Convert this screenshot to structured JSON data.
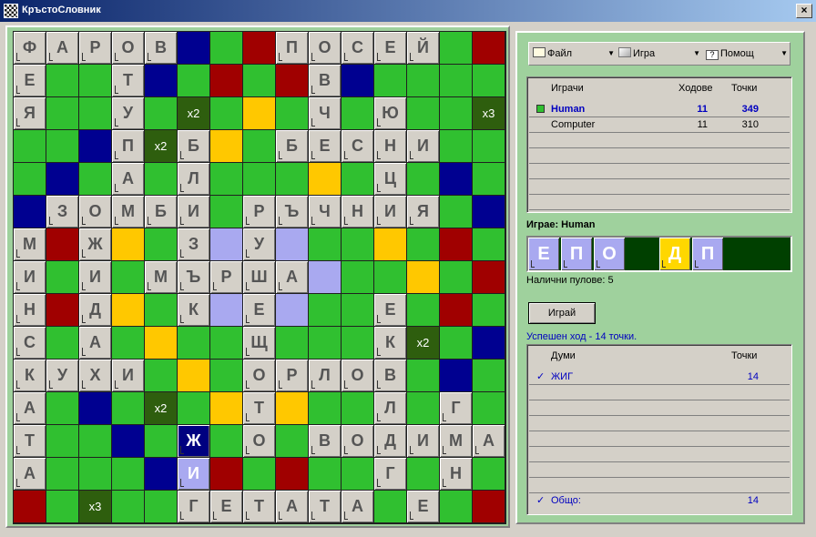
{
  "window": {
    "title": "КръстоСловник",
    "close_label": "×"
  },
  "colors": {
    "green": "#30c030",
    "red": "#a00000",
    "blue": "#000090",
    "yellow": "#ffc800",
    "lightblue": "#a9a9f0",
    "darkgreen": "#2e5e0e",
    "tile": "#d4d0c8"
  },
  "board": {
    "rows": [
      "ФАРОВ.. ПОСЕЙ..",
      "Е..Т.....В.....",
      "Я..У.....Ч.Ю...",
      "...П.Б..БЕСНИ..",
      "....А.Л....Ц...",
      ".ЗОМБИ.РЪЧНИЯ..",
      "М..Ж..З.У......",
      "И..И.МЪРША.....",
      "Н..Д..К.Е..Е...",
      "С..А.....Щ..К..",
      "КУХИ....ОРЛОВ..",
      "А........Т..Л.Г",
      "Т........ЖО.ВОДИМА",
      "А........И......Г.Н",
      "......ГЕТАТА.Е.."
    ],
    "cells": [
      [
        "Ф",
        "А",
        "Р",
        "О",
        "В",
        "",
        "",
        "",
        "П",
        "О",
        "С",
        "Е",
        "Й",
        "",
        ""
      ],
      [
        "Е",
        "",
        "",
        "Т",
        "",
        "",
        "",
        "",
        "",
        "В",
        "",
        "",
        "",
        "",
        ""
      ],
      [
        "Я",
        "",
        "",
        "У",
        "",
        "",
        "",
        "",
        "",
        "Ч",
        "",
        "Ю",
        "",
        "",
        ""
      ],
      [
        "",
        "",
        "",
        "П",
        "",
        "Б",
        "",
        "",
        "Б",
        "Е",
        "С",
        "Н",
        "И",
        "",
        ""
      ],
      [
        "",
        "",
        "",
        "А",
        "",
        "Л",
        "",
        "",
        "",
        "",
        "",
        "Ц",
        "",
        "",
        ""
      ],
      [
        "",
        "З",
        "О",
        "М",
        "Б",
        "И",
        "",
        "Р",
        "Ъ",
        "Ч",
        "Н",
        "И",
        "Я",
        "",
        ""
      ],
      [
        "М",
        "",
        "Ж",
        "",
        "",
        "З",
        "",
        "У",
        "",
        "",
        "",
        "",
        "",
        "",
        ""
      ],
      [
        "И",
        "",
        "И",
        "",
        "М",
        "Ъ",
        "Р",
        "Ш",
        "А",
        "",
        "",
        "",
        "",
        "",
        ""
      ],
      [
        "Н",
        "",
        "Д",
        "",
        "",
        "К",
        "",
        "Е",
        "",
        "",
        "",
        "Е",
        "",
        "",
        ""
      ],
      [
        "С",
        "",
        "А",
        "",
        "",
        "",
        "",
        "Щ",
        "",
        "",
        "",
        "К",
        "",
        "",
        ""
      ],
      [
        "К",
        "У",
        "Х",
        "И",
        "",
        "",
        "",
        "О",
        "Р",
        "Л",
        "О",
        "В",
        "",
        "",
        ""
      ],
      [
        "А",
        "",
        "",
        "",
        "",
        "",
        "",
        "Т",
        "",
        "",
        "",
        "Л",
        "",
        "Г",
        ""
      ],
      [
        "Т",
        "",
        "",
        "",
        "",
        "Ж",
        "",
        "О",
        "",
        "В",
        "О",
        "Д",
        "И",
        "М",
        "А"
      ],
      [
        "А",
        "",
        "",
        "",
        "",
        "И",
        "",
        "",
        "",
        "",
        "",
        "Г",
        "",
        "Н",
        ""
      ],
      [
        "",
        "",
        "",
        "",
        "",
        "Г",
        "Е",
        "Т",
        "А",
        "Т",
        "А",
        "",
        "Е",
        "",
        ""
      ]
    ],
    "bonus_labels": {
      "x2": "x2",
      "x3": "x3"
    }
  },
  "toolbar": {
    "file_label": "Файл",
    "game_label": "Игра",
    "help_label": "Помощ",
    "file_icon": "folder-icon",
    "game_icon": "gem-icon",
    "help_icon": "help-icon"
  },
  "players": {
    "headers": {
      "name": "Играчи",
      "moves": "Ходове",
      "points": "Точки"
    },
    "rows": [
      {
        "name": "Human",
        "moves": "11",
        "points": "349",
        "active": true
      },
      {
        "name": "Computer",
        "moves": "11",
        "points": "310",
        "active": false
      }
    ]
  },
  "current_player_label": "Играе: Human",
  "rack": {
    "tiles": [
      "Е",
      "П",
      "О",
      "",
      "Д",
      "П"
    ],
    "highlighted_index": 4
  },
  "pool_label": "Налични пулове: 5",
  "play_button": "Играй",
  "status_message": "Успешен ход - 14 точки.",
  "words": {
    "headers": {
      "word": "Думи",
      "points": "Точки"
    },
    "rows": [
      {
        "word": "ЖИГ",
        "points": "14"
      }
    ],
    "total_label": "Общо:",
    "total_points": "14"
  }
}
